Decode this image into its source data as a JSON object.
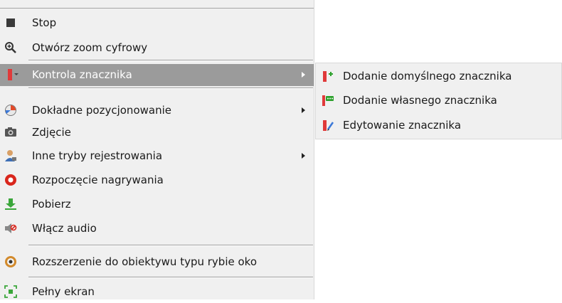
{
  "menu": {
    "items": [
      {
        "label": "Stop",
        "icon": "stop-icon"
      },
      {
        "label": "Otwórz zoom cyfrowy",
        "icon": "zoom-icon"
      },
      {
        "label": "Kontrola znacznika",
        "icon": "bookmark-menu-icon",
        "submenu": true,
        "highlighted": true
      },
      {
        "label": "Dokładne pozycjonowanie",
        "icon": "positioning-icon",
        "submenu": true
      },
      {
        "label": "Zdjęcie",
        "icon": "camera-icon"
      },
      {
        "label": "Inne tryby rejestrowania",
        "icon": "user-icon",
        "submenu": true
      },
      {
        "label": "Rozpoczęcie nagrywania",
        "icon": "record-icon"
      },
      {
        "label": "Pobierz",
        "icon": "download-icon"
      },
      {
        "label": "Włącz audio",
        "icon": "audio-muted-icon"
      },
      {
        "label": "Rozszerzenie do obiektywu typu rybie oko",
        "icon": "fisheye-icon"
      },
      {
        "label": "Pełny ekran",
        "icon": "fullscreen-icon"
      }
    ]
  },
  "submenu": {
    "items": [
      {
        "label": "Dodanie domyślnego znacznika",
        "icon": "add-default-marker-icon"
      },
      {
        "label": "Dodanie własnego znacznika",
        "icon": "add-custom-marker-icon"
      },
      {
        "label": "Edytowanie znacznika",
        "icon": "edit-marker-icon"
      }
    ]
  },
  "colors": {
    "menu_bg": "#f0f0f0",
    "highlight_bg": "#9b9b9b",
    "marker_red": "#e03a3a",
    "record_red": "#d9261c",
    "download_green": "#3aa63a"
  }
}
